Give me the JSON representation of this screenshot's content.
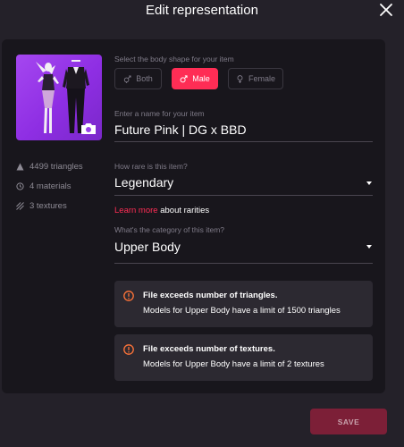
{
  "modal": {
    "title": "Edit representation"
  },
  "stats": {
    "triangles": "4499 triangles",
    "materials": "4 materials",
    "textures": "3 textures"
  },
  "body_shape": {
    "label": "Select the body shape for your item",
    "options": [
      {
        "label": "Both",
        "icon": "both-gender-icon",
        "selected": false
      },
      {
        "label": "Male",
        "icon": "male-icon",
        "selected": true
      },
      {
        "label": "Female",
        "icon": "female-icon",
        "selected": false
      }
    ]
  },
  "name_field": {
    "label": "Enter a name for your item",
    "value": "Future Pink  | DG x BBD"
  },
  "rarity": {
    "label": "How rare is this item?",
    "value": "Legendary",
    "learn_more": "Learn more",
    "about_text": " about rarities"
  },
  "category": {
    "label": "What's the category of this item?",
    "value": "Upper Body"
  },
  "alerts": [
    {
      "title": "File exceeds number of triangles.",
      "body": "Models for Upper Body have a limit of 1500 triangles"
    },
    {
      "title": "File exceeds number of textures.",
      "body": "Models for Upper Body have a limit of 2 textures"
    }
  ],
  "actions": {
    "save": "SAVE"
  },
  "colors": {
    "accent": "#ff2d55",
    "background": "#242129",
    "panel": "#18161c",
    "thumbnail": "#a547f0",
    "alert_icon": "#ff7439"
  }
}
